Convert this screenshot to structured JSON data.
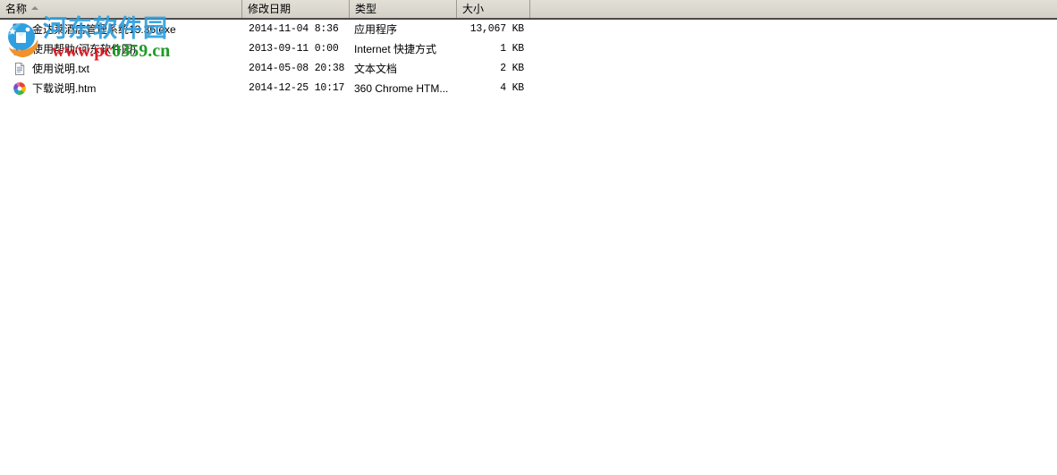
{
  "window": {
    "kind": "file-explorer-list-view"
  },
  "columns": [
    {
      "key": "name",
      "label": "名称",
      "sorted": "ascending"
    },
    {
      "key": "date",
      "label": "修改日期",
      "sorted": "none"
    },
    {
      "key": "type",
      "label": "类型",
      "sorted": "none"
    },
    {
      "key": "size",
      "label": "大小",
      "sorted": "none"
    }
  ],
  "files": [
    {
      "icon": "application-exe-icon",
      "name": "金达莱酒店管理系统13.36.exe",
      "date": "2014-11-04 8:36",
      "type": "应用程序",
      "size": "13,067 KB"
    },
    {
      "icon": "internet-shortcut-icon",
      "name": "使用帮助(河东软件园)",
      "date": "2013-09-11 0:00",
      "type": "Internet 快捷方式",
      "size": "1 KB"
    },
    {
      "icon": "text-document-icon",
      "name": "使用说明.txt",
      "date": "2014-05-08 20:38",
      "type": "文本文档",
      "size": "2 KB"
    },
    {
      "icon": "chrome-html-icon",
      "name": "下载说明.htm",
      "date": "2014-12-25 10:17",
      "type": "360 Chrome HTM...",
      "size": "4 KB"
    }
  ],
  "watermark": {
    "site_name": "河东软件园",
    "url_part_a": "www.pc",
    "url_part_b": "0359.cn",
    "site_color": "#2f9fe0",
    "url_color_a": "#e0202a",
    "url_color_b": "#1f9b27"
  },
  "colors": {
    "header_bg": "#dbd8d0",
    "header_border": "#4a4a48",
    "list_bg": "#ffffff",
    "text": "#000000"
  }
}
